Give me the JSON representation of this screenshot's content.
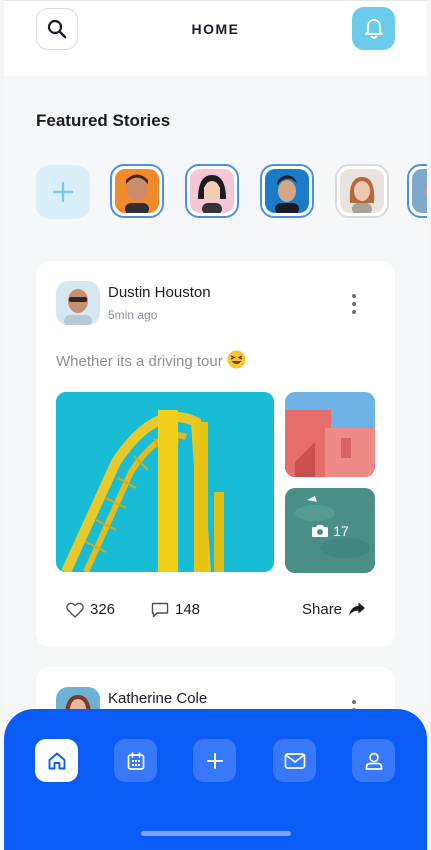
{
  "header": {
    "title": "HOME",
    "search_icon": "search-icon",
    "notification_icon": "bell-icon"
  },
  "stories": {
    "section_title": "Featured Stories",
    "add_icon": "plus-icon",
    "items": [
      {
        "seen": false
      },
      {
        "seen": false
      },
      {
        "seen": false
      },
      {
        "seen": true
      },
      {
        "seen": false
      }
    ]
  },
  "posts": [
    {
      "author": "Dustin Houston",
      "time": "5min ago",
      "text": "Whether its a driving tour",
      "extra_photos": "17",
      "likes": "326",
      "comments": "148",
      "share_label": "Share"
    },
    {
      "author": "Katherine Cole"
    }
  ],
  "bottom_nav": {
    "items": [
      {
        "icon": "home-icon",
        "active": true
      },
      {
        "icon": "calendar-icon",
        "active": false
      },
      {
        "icon": "plus-icon",
        "active": false
      },
      {
        "icon": "mail-icon",
        "active": false
      },
      {
        "icon": "user-icon",
        "active": false
      }
    ]
  },
  "colors": {
    "accent": "#0b5cf7",
    "bell_bg": "#6ccbeb",
    "story_ring": "#4a90e8"
  }
}
